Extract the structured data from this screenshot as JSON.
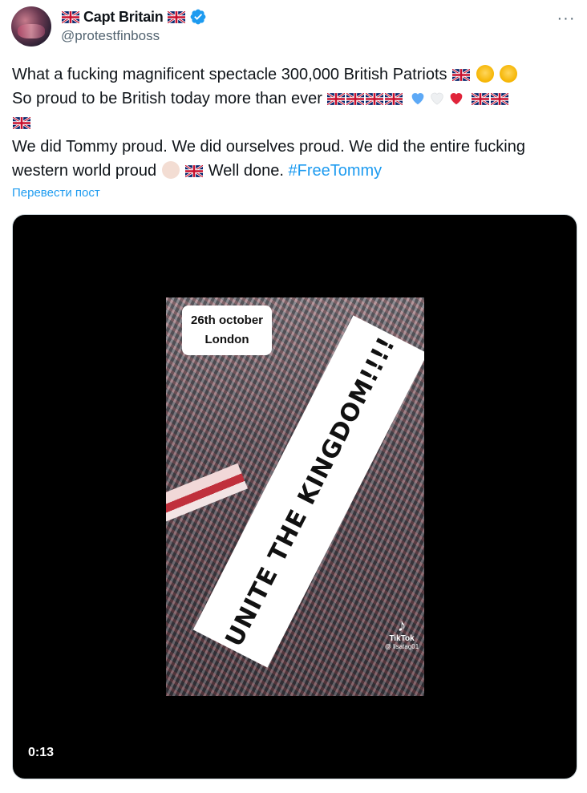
{
  "user": {
    "display_name": "Capt Britain",
    "handle": "@protestfinboss",
    "verified": true,
    "avatar_icon": "avatar-image"
  },
  "more_icon": "more-horizontal-icon",
  "tweet": {
    "line1_text": "What a fucking magnificent spectacle  300,000 British Patriots",
    "line2_text": "So proud to be British today more than ever",
    "line4_text": "We did Tommy proud. We did ourselves proud. We did the entire fucking",
    "line5_text": "western world proud",
    "line5_after": "Well done.",
    "hashtag": "#FreeTommy"
  },
  "translate_label": "Перевести пост",
  "media": {
    "overlay_date_line1": "26th october",
    "overlay_date_line2": "London",
    "overlay_slogan": "UNITE THE KINGDOM!!!!",
    "tiktok_brand": "TikTok",
    "tiktok_user": "@ lisatag01",
    "duration": "0:13"
  },
  "colors": {
    "accent": "#1d9bf0",
    "text": "#0f1419",
    "secondary": "#536471",
    "media_bg": "#000000"
  }
}
